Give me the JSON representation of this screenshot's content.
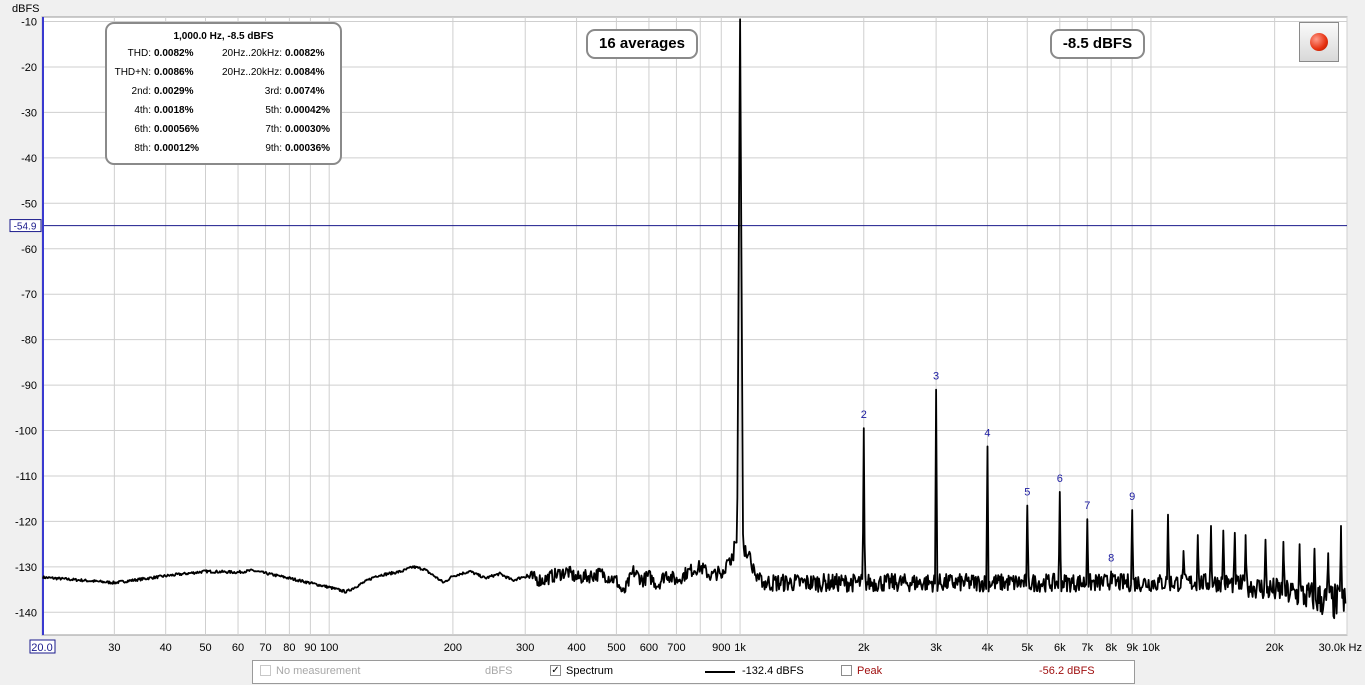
{
  "chart_data": {
    "type": "line",
    "y_unit": "dBFS",
    "x_unit": "Hz",
    "x_scale": "log",
    "xlim": [
      20,
      30000
    ],
    "ylim": [
      -145,
      -9
    ],
    "grid": true,
    "y_ticks": [
      {
        "v": -10,
        "label": "-10"
      },
      {
        "v": -20,
        "label": "-20"
      },
      {
        "v": -30,
        "label": "-30"
      },
      {
        "v": -40,
        "label": "-40"
      },
      {
        "v": -50,
        "label": "-50"
      },
      {
        "v": -60,
        "label": "-60"
      },
      {
        "v": -70,
        "label": "-70"
      },
      {
        "v": -80,
        "label": "-80"
      },
      {
        "v": -90,
        "label": "-90"
      },
      {
        "v": -100,
        "label": "-100"
      },
      {
        "v": -110,
        "label": "-110"
      },
      {
        "v": -120,
        "label": "-120"
      },
      {
        "v": -130,
        "label": "-130"
      },
      {
        "v": -140,
        "label": "-140"
      }
    ],
    "x_ticks": [
      {
        "v": 30,
        "label": "30"
      },
      {
        "v": 40,
        "label": "40"
      },
      {
        "v": 50,
        "label": "50"
      },
      {
        "v": 60,
        "label": "60"
      },
      {
        "v": 70,
        "label": "70"
      },
      {
        "v": 80,
        "label": "80"
      },
      {
        "v": 90,
        "label": "90"
      },
      {
        "v": 100,
        "label": "100"
      },
      {
        "v": 200,
        "label": "200"
      },
      {
        "v": 300,
        "label": "300"
      },
      {
        "v": 400,
        "label": "400"
      },
      {
        "v": 500,
        "label": "500"
      },
      {
        "v": 600,
        "label": "600"
      },
      {
        "v": 700,
        "label": "700"
      },
      {
        "v": 900,
        "label": "900"
      },
      {
        "v": 1000,
        "label": "1k"
      },
      {
        "v": 2000,
        "label": "2k"
      },
      {
        "v": 3000,
        "label": "3k"
      },
      {
        "v": 4000,
        "label": "4k"
      },
      {
        "v": 5000,
        "label": "5k"
      },
      {
        "v": 6000,
        "label": "6k"
      },
      {
        "v": 7000,
        "label": "7k"
      },
      {
        "v": 8000,
        "label": "8k"
      },
      {
        "v": 9000,
        "label": "9k"
      },
      {
        "v": 10000,
        "label": "10k"
      },
      {
        "v": 20000,
        "label": "20k"
      }
    ],
    "x_start_label": "20.0",
    "x_end_label": "30.0k Hz",
    "cursor_y": {
      "value": -54.9,
      "label": "-54.9"
    },
    "harmonics": [
      {
        "n": "2",
        "freq": 2000,
        "level": -99.5
      },
      {
        "n": "3",
        "freq": 3000,
        "level": -91
      },
      {
        "n": "4",
        "freq": 4000,
        "level": -103.5
      },
      {
        "n": "5",
        "freq": 5000,
        "level": -116.5
      },
      {
        "n": "6",
        "freq": 6000,
        "level": -113.5
      },
      {
        "n": "7",
        "freq": 7000,
        "level": -119.5
      },
      {
        "n": "8",
        "freq": 8000,
        "level": -131
      },
      {
        "n": "9",
        "freq": 9000,
        "level": -117.5
      }
    ],
    "extra_peaks": [
      {
        "freq": 11000,
        "level": -118.5
      },
      {
        "freq": 12000,
        "level": -126.5
      },
      {
        "freq": 13000,
        "level": -123
      },
      {
        "freq": 14000,
        "level": -121
      },
      {
        "freq": 15000,
        "level": -122
      },
      {
        "freq": 16000,
        "level": -122.5
      },
      {
        "freq": 17000,
        "level": -123
      },
      {
        "freq": 19000,
        "level": -124
      },
      {
        "freq": 21000,
        "level": -124.5
      },
      {
        "freq": 23000,
        "level": -125
      },
      {
        "freq": 25000,
        "level": -126
      },
      {
        "freq": 27000,
        "level": -127
      },
      {
        "freq": 29000,
        "level": -121
      }
    ],
    "fundamental": {
      "freq": 1000,
      "level": -9.5
    },
    "floor_points": [
      [
        20,
        -132.3
      ],
      [
        30,
        -133.5
      ],
      [
        40,
        -132
      ],
      [
        50,
        -131
      ],
      [
        60,
        -131.2
      ],
      [
        65,
        -130.8
      ],
      [
        80,
        -132.5
      ],
      [
        100,
        -134.5
      ],
      [
        110,
        -135.5
      ],
      [
        130,
        -132
      ],
      [
        150,
        -131
      ],
      [
        160,
        -130
      ],
      [
        170,
        -130.5
      ],
      [
        180,
        -132
      ],
      [
        190,
        -133.5
      ],
      [
        200,
        -132
      ],
      [
        220,
        -131
      ],
      [
        240,
        -132.5
      ],
      [
        260,
        -131.5
      ],
      [
        280,
        -133
      ],
      [
        300,
        -132
      ],
      [
        330,
        -133
      ],
      [
        350,
        -132
      ],
      [
        380,
        -131
      ],
      [
        400,
        -132.5
      ],
      [
        430,
        -132
      ],
      [
        460,
        -131.5
      ],
      [
        500,
        -133
      ],
      [
        520,
        -136
      ],
      [
        550,
        -131
      ],
      [
        580,
        -133
      ],
      [
        600,
        -132
      ],
      [
        630,
        -134
      ],
      [
        660,
        -131.5
      ],
      [
        700,
        -133
      ],
      [
        750,
        -131
      ],
      [
        800,
        -130
      ],
      [
        850,
        -132
      ],
      [
        900,
        -131
      ],
      [
        950,
        -129
      ]
    ],
    "series": [
      {
        "name": "Spectrum",
        "value_label": "-132.4 dBFS"
      }
    ]
  },
  "info_box": {
    "title": "1,000.0 Hz, -8.5 dBFS",
    "rows": [
      [
        {
          "k": "THD:",
          "v": "0.0082%"
        },
        {
          "k": "20Hz..20kHz:",
          "v": "0.0082%"
        }
      ],
      [
        {
          "k": "THD+N:",
          "v": "0.0086%"
        },
        {
          "k": "20Hz..20kHz:",
          "v": "0.0084%"
        }
      ],
      [
        {
          "k": "2nd:",
          "v": "0.0029%"
        },
        {
          "k": "3rd:",
          "v": "0.0074%"
        }
      ],
      [
        {
          "k": "4th:",
          "v": "0.0018%"
        },
        {
          "k": "5th:",
          "v": "0.00042%"
        }
      ],
      [
        {
          "k": "6th:",
          "v": "0.00056%"
        },
        {
          "k": "7th:",
          "v": "0.00030%"
        }
      ],
      [
        {
          "k": "8th:",
          "v": "0.00012%"
        },
        {
          "k": "9th:",
          "v": "0.00036%"
        }
      ]
    ]
  },
  "averages_badge": "16 averages",
  "level_badge": "-8.5 dBFS",
  "legend": {
    "no_measurement": "No measurement",
    "no_measurement_unit": "dBFS",
    "spectrum_label": "Spectrum",
    "spectrum_checked": true,
    "spectrum_value": "-132.4 dBFS",
    "peak_label": "Peak",
    "peak_checked": false,
    "peak_value": "-56.2 dBFS"
  },
  "colors": {
    "plot_bg": "#ffffff",
    "grid": "#c8c8c8",
    "trace": "#000000",
    "cursor": "#1a1a8c",
    "harmonic_label": "#1a1aa0",
    "peak_text": "#a01010"
  }
}
